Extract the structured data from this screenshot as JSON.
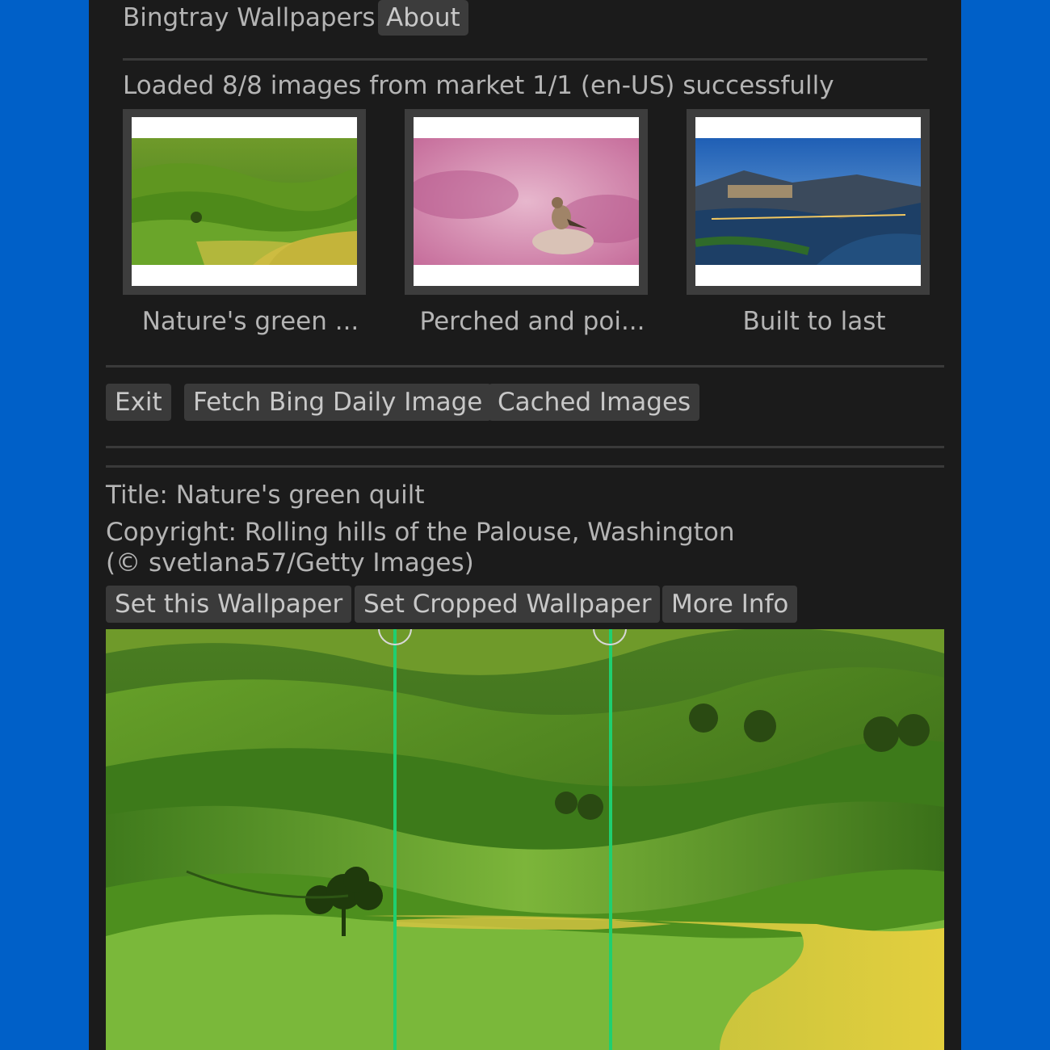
{
  "menu": {
    "app_title": "Bingtray Wallpapers",
    "about_label": "About"
  },
  "status": {
    "text": "Loaded 8/8 images from market 1/1 (en-US) successfully"
  },
  "thumbnails": [
    {
      "caption": "Nature's green ...",
      "icon": "rolling-green-hills-image"
    },
    {
      "caption": "Perched and poi...",
      "icon": "bird-on-rock-pink-flowers-image"
    },
    {
      "caption": "Built to last",
      "icon": "coastal-town-at-dusk-image"
    }
  ],
  "actions": {
    "exit_label": "Exit",
    "fetch_label": "Fetch Bing Daily Image",
    "cached_label": "Cached Images"
  },
  "details": {
    "title": "Title: Nature's green quilt",
    "copyright": "Copyright: Rolling hills of the Palouse, Washington (© svetlana57/Getty Images)",
    "set_wallpaper_label": "Set this Wallpaper",
    "set_cropped_label": "Set Cropped Wallpaper",
    "more_info_label": "More Info"
  },
  "colors": {
    "background": "#0060c8",
    "panel": "#1b1b1b",
    "button": "#3a3a3a",
    "crop_line": "#1fcf70"
  }
}
